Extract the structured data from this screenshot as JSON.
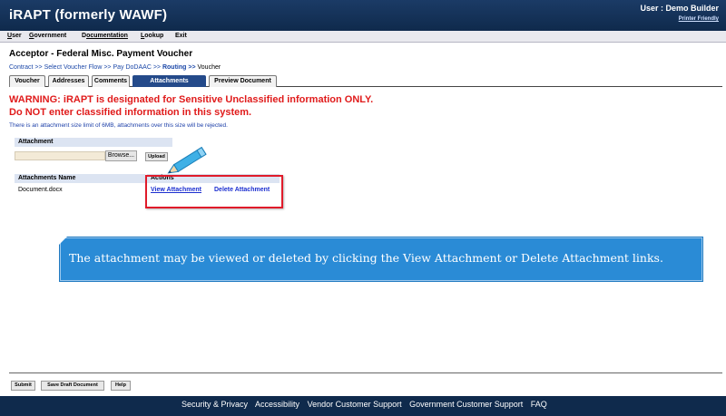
{
  "header": {
    "app_title": "iRAPT (formerly WAWF)",
    "user_label": "User : Demo Builder",
    "printer_link": "Printer Friendly"
  },
  "menu": {
    "items": [
      {
        "key": "U",
        "rest": "ser"
      },
      {
        "key": "G",
        "rest": "overnment"
      },
      {
        "key": "D",
        "pre": "",
        "rest": "ocumentation",
        "label": "Documentation"
      },
      {
        "key": "L",
        "rest": "ookup"
      },
      {
        "key": "",
        "rest": "Exit"
      }
    ]
  },
  "page": {
    "title": "Acceptor - Federal Misc. Payment Voucher"
  },
  "breadcrumb": {
    "contract": "Contract",
    "select_voucher_flow": "Select Voucher Flow",
    "pay_dodaac": "Pay DoDAAC",
    "routing": "Routing",
    "voucher": "Voucher",
    "sep": ">>"
  },
  "tabs": [
    {
      "label": "Voucher",
      "active": false
    },
    {
      "label": "Addresses",
      "active": false
    },
    {
      "label": "Comments",
      "active": false
    },
    {
      "label": "Attachments",
      "active": true
    },
    {
      "label": "Preview Document",
      "active": false
    }
  ],
  "warnings": {
    "line1": "WARNING: iRAPT is designated for Sensitive Unclassified information ONLY.",
    "line2": "Do NOT enter classified information in this system."
  },
  "size_note": "There is an attachment size limit of 6MB, attachments over this size will be rejected.",
  "attachment_form": {
    "header": "Attachment",
    "file_value": "",
    "browse_label": "Browse...",
    "upload_label": "Upload"
  },
  "attachments_table": {
    "header_name": "Attachments Name",
    "header_actions": "Actions",
    "rows": [
      {
        "name": "Document.docx",
        "view_label": "View Attachment",
        "delete_label": "Delete Attachment"
      }
    ]
  },
  "callout": {
    "text": "The attachment may be viewed or deleted by clicking the View Attachment or Delete Attachment links."
  },
  "bottom_buttons": {
    "submit": "Submit",
    "save_draft": "Save Draft Document",
    "help": "Help"
  },
  "footer": {
    "links": [
      "Security & Privacy",
      "Accessibility",
      "Vendor Customer Support",
      "Government Customer Support",
      "FAQ"
    ]
  },
  "colors": {
    "header_bg": "#1b3b66",
    "warning": "#e01b1b",
    "callout_bg": "#2a8bd6",
    "active_tab": "#244a8a",
    "highlight": "#e01b2a"
  }
}
